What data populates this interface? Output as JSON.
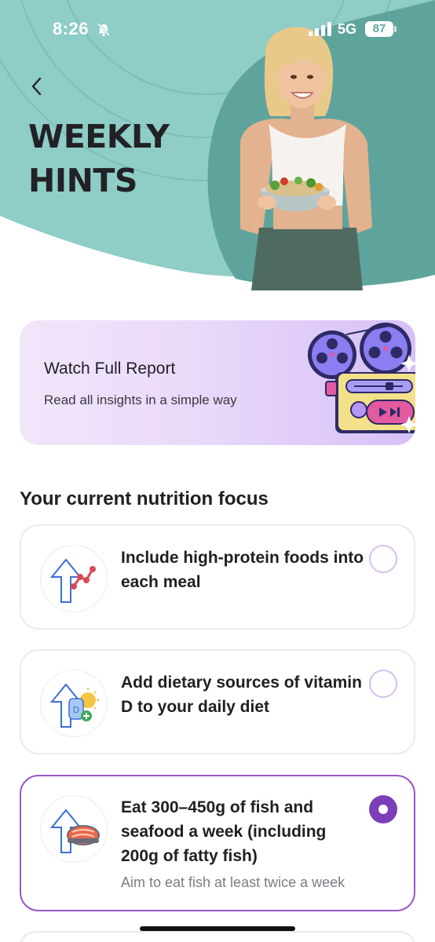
{
  "status_bar": {
    "time": "8:26",
    "network": "5G",
    "battery": "87"
  },
  "header": {
    "title_line1": "WEEKLY",
    "title_line2": "HINTS"
  },
  "report_card": {
    "title": "Watch Full Report",
    "subtitle": "Read all insights in a simple way"
  },
  "focus": {
    "heading": "Your current nutrition focus",
    "items": [
      {
        "title": "Include high-protein foods into each meal",
        "icon": "protein-chart-icon",
        "selected": false
      },
      {
        "title": "Add dietary sources of vitamin D to your daily diet",
        "icon": "vitamin-d-icon",
        "selected": false
      },
      {
        "title": "Eat 300–450g of fish and seafood a week (including 200g of fatty fish)",
        "note": "Aim to eat fish at least twice a week",
        "icon": "fish-steak-icon",
        "selected": true
      }
    ]
  },
  "colors": {
    "hero_teal": "#8fcdc7",
    "hero_dark_teal": "#5fa39d",
    "accent_purple": "#7b3fb8",
    "card_lavender": "#e9d9fa"
  }
}
